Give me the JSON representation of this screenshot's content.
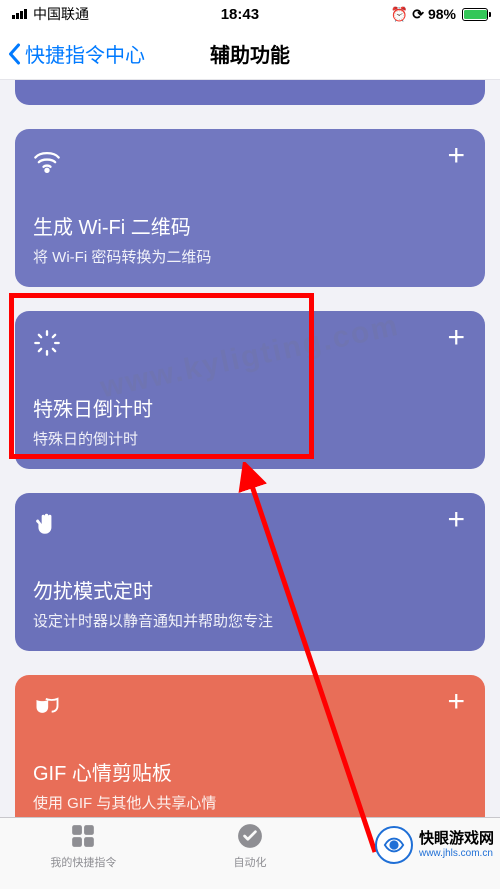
{
  "status": {
    "carrier": "中国联通",
    "time": "18:43",
    "alarm_icon": "alarm",
    "rotate_icon": "rotation-lock",
    "battery_pct": "98%"
  },
  "nav": {
    "back_label": "快捷指令中心",
    "title": "辅助功能"
  },
  "cards": [
    {
      "icon": "wifi-icon",
      "title": "生成 Wi-Fi 二维码",
      "sub": "将 Wi-Fi 密码转换为二维码",
      "add": "+"
    },
    {
      "icon": "wand-icon",
      "title": "特殊日倒计时",
      "sub": "特殊日的倒计时",
      "add": "+"
    },
    {
      "icon": "hand-icon",
      "title": "勿扰模式定时",
      "sub": "设定计时器以静音通知并帮助您专注",
      "add": "+"
    },
    {
      "icon": "masks-icon",
      "title": "GIF 心情剪贴板",
      "sub": "使用 GIF 与其他人共享心情",
      "add": "+"
    }
  ],
  "tabs": {
    "t1": "我的快捷指令",
    "t2": "自动化",
    "t3": ""
  },
  "watermark": "www.kyligting.com",
  "brand": {
    "name": "快眼游戏网",
    "url": "www.jhls.com.cn"
  }
}
